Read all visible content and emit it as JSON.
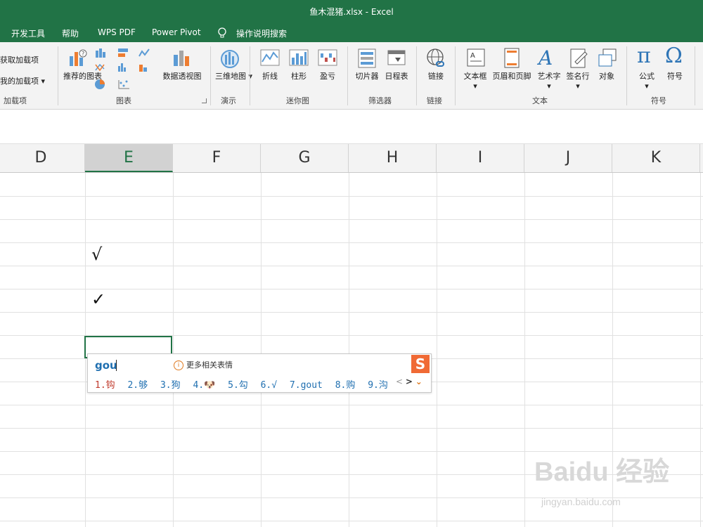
{
  "window": {
    "title": "鱼木混猪.xlsx  -  Excel"
  },
  "menu": [
    "开发工具",
    "帮助",
    "WPS PDF",
    "Power Pivot",
    "操作说明搜索"
  ],
  "ribbon": {
    "addins": {
      "get": "获取加载项",
      "mine": "我的加载项",
      "label": "加载项"
    },
    "charts": {
      "recommended": "推荐的图表",
      "pivot": "数据透视图",
      "label": "图表"
    },
    "tours": {
      "map": "三维地图",
      "label": "演示"
    },
    "sparklines": {
      "line": "折线",
      "column": "柱形",
      "winloss": "盈亏",
      "label": "迷你图"
    },
    "filters": {
      "slicer": "切片器",
      "timeline": "日程表",
      "label": "筛选器"
    },
    "links": {
      "link": "链接",
      "label": "链接"
    },
    "text": {
      "textbox": "文本框",
      "header": "页眉和页脚",
      "wordart": "艺术字",
      "signature": "签名行",
      "object": "对象",
      "label": "文本"
    },
    "symbols": {
      "equation": "公式",
      "symbol": "符号",
      "label": "符号"
    }
  },
  "columns": [
    "D",
    "E",
    "F",
    "G",
    "H",
    "I",
    "J",
    "K"
  ],
  "cells": {
    "e1": "√",
    "e2": "✓"
  },
  "ime": {
    "input": "gou",
    "hint": "更多相关表情",
    "candidates": [
      "1.钩",
      "2.够",
      "3.狗",
      "4.🐶",
      "5.勾",
      "6.√",
      "7.gout",
      "8.购",
      "9.沟"
    ],
    "logo": "S",
    "nav_prev": "<",
    "nav_next": ">",
    "expand": "⌄"
  },
  "watermark": {
    "main": "Baidu 经验",
    "sub": "jingyan.baidu.com"
  },
  "colors": {
    "accent": "#217346"
  }
}
